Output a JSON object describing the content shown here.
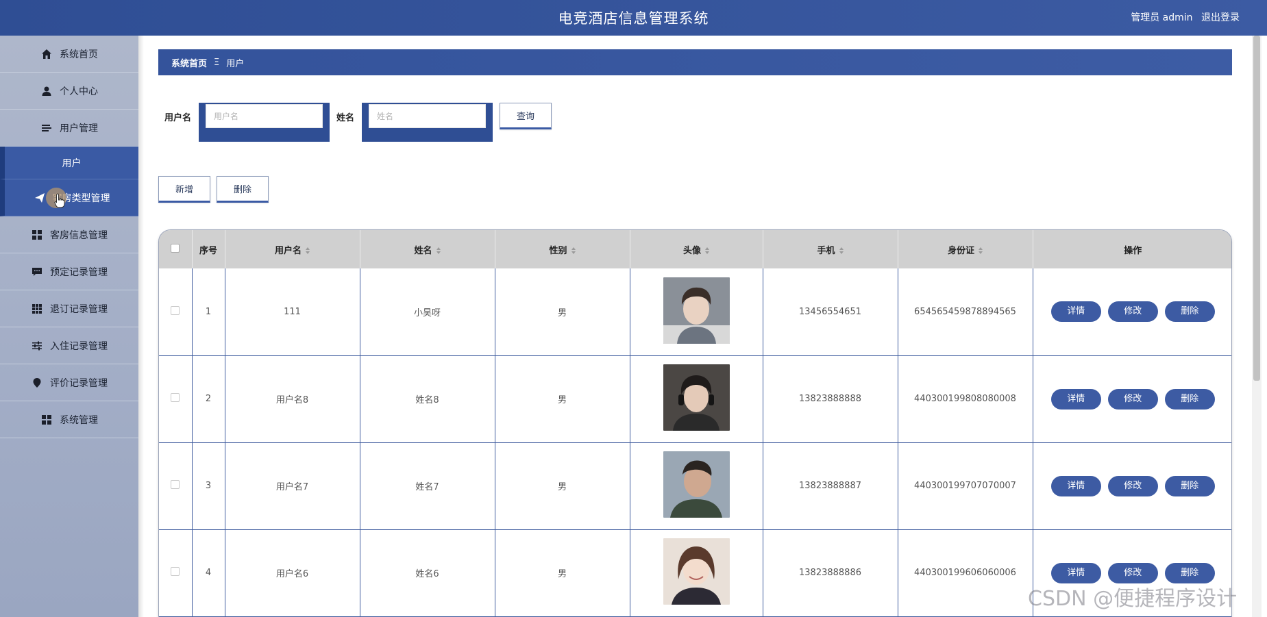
{
  "header": {
    "title": "电竞酒店信息管理系统",
    "user": "管理员 admin",
    "logout": "退出登录"
  },
  "sidebar": {
    "items": [
      {
        "label": "系统首页",
        "icon": "home-icon"
      },
      {
        "label": "个人中心",
        "icon": "user-icon"
      },
      {
        "label": "用户管理",
        "icon": "list-icon"
      },
      {
        "label": "用户",
        "icon": ""
      },
      {
        "label": "客房类型管理",
        "icon": "send-icon"
      },
      {
        "label": "客房信息管理",
        "icon": "grid-icon"
      },
      {
        "label": "预定记录管理",
        "icon": "chat-icon"
      },
      {
        "label": "退订记录管理",
        "icon": "apps-icon"
      },
      {
        "label": "入住记录管理",
        "icon": "sliders-icon"
      },
      {
        "label": "评价记录管理",
        "icon": "pin-icon"
      },
      {
        "label": "系统管理",
        "icon": "grid-icon"
      }
    ]
  },
  "breadcrumb": {
    "home": "系统首页",
    "separator": "Ξ",
    "current": "用户"
  },
  "search": {
    "username_label": "用户名",
    "username_placeholder": "用户名",
    "name_label": "姓名",
    "name_placeholder": "姓名",
    "query_button": "查询"
  },
  "toolbar": {
    "add_button": "新增",
    "delete_button": "删除"
  },
  "table": {
    "columns": [
      "序号",
      "用户名",
      "姓名",
      "性别",
      "头像",
      "手机",
      "身份证",
      "操作"
    ],
    "rows": [
      {
        "no": "1",
        "username": "111",
        "name": "小昊呀",
        "gender": "男",
        "phone": "13456554651",
        "idcard": "654565459878894565"
      },
      {
        "no": "2",
        "username": "用户名8",
        "name": "姓名8",
        "gender": "男",
        "phone": "13823888888",
        "idcard": "440300199808080008"
      },
      {
        "no": "3",
        "username": "用户名7",
        "name": "姓名7",
        "gender": "男",
        "phone": "13823888887",
        "idcard": "440300199707070007"
      },
      {
        "no": "4",
        "username": "用户名6",
        "name": "姓名6",
        "gender": "男",
        "phone": "13823888886",
        "idcard": "440300199606060006"
      }
    ],
    "actions": {
      "detail": "详情",
      "edit": "修改",
      "delete": "删除"
    }
  },
  "watermark": "CSDN @便捷程序设计",
  "colors": {
    "primary": "#3a5aa4",
    "header": "#2f4e94",
    "sidebar": "#a8b2c8"
  }
}
